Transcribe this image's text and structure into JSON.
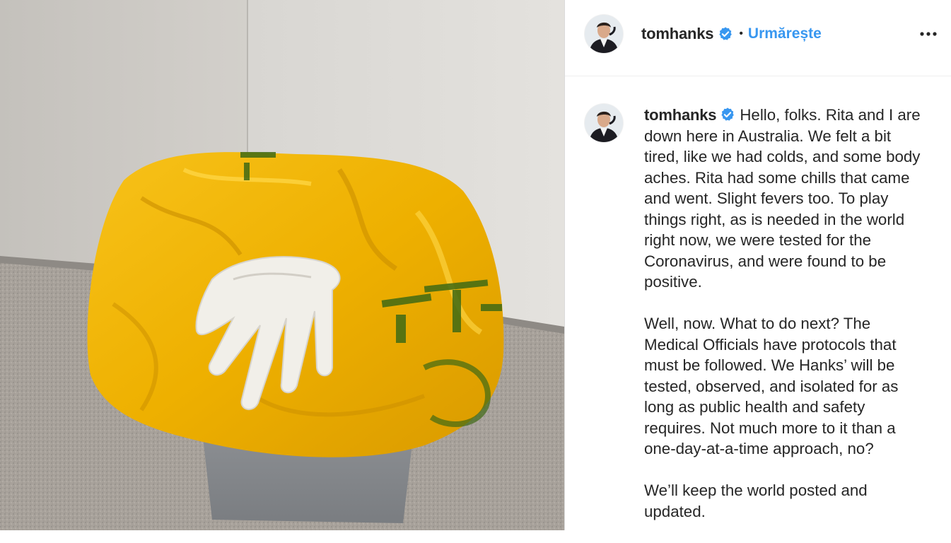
{
  "post": {
    "image_alt": "Yellow biohazard waste bag in a grey bin with a white latex glove on top",
    "author": {
      "username": "tomhanks",
      "verified": true,
      "follow_label": "Urmărește"
    },
    "more_options_icon": "more-horizontal-icon",
    "caption": {
      "paragraphs": [
        "Hello, folks. Rita and I are down here in Australia. We felt a bit tired, like we had colds, and some body aches. Rita had some chills that came and went. Slight fevers too. To play things right, as is needed in the world right now, we were tested for the Coronavirus, and were found to be positive.",
        "Well, now. What to do next? The Medical Officials have protocols that must be followed. We Hanks’ will be tested, observed, and isolated for as long as public health and safety requires. Not much more to it than a one-day-at-a-time approach, no?",
        "We’ll keep the world posted and updated."
      ]
    }
  },
  "colors": {
    "link_blue": "#3897f0",
    "verified_blue": "#3897f0",
    "text": "#262626",
    "bag_yellow": "#f2b705"
  }
}
